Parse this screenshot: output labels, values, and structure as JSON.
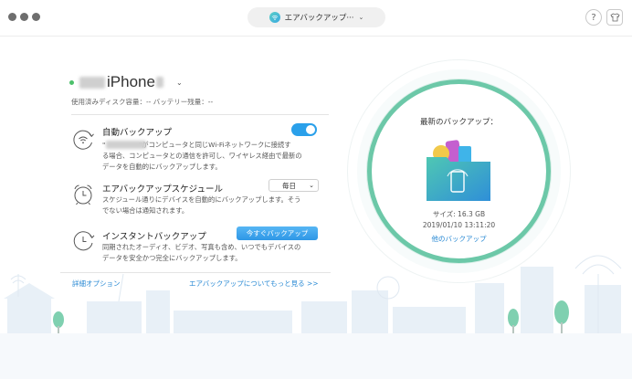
{
  "header": {
    "mode_label": "エアバックアップ···",
    "help_label": "?"
  },
  "device": {
    "name": "iPhone",
    "storage_line": "使用済みディスク容量：-- バッテリー残量：--"
  },
  "options": {
    "auto_backup": {
      "title": "自動バックアップ",
      "desc_line1": "\"　　　　　\"がコンピュータと同じWi-Fiネットワークに接続す",
      "desc_line2": "る場合、コンピュータとの通信を許可し、ワイヤレス経由で最新の",
      "desc_line3": "データを自動的にバックアップします。",
      "enabled": true
    },
    "schedule": {
      "title": "エアバックアップスケジュール",
      "select_value": "毎日",
      "desc_line1": "スケジュール通りにデバイスを自動的にバックアップします。そう",
      "desc_line2": "でない場合は通知されます。"
    },
    "instant": {
      "title": "インスタントバックアップ",
      "button_label": "今すぐバックアップ",
      "desc_line1": "同期されたオーディオ、ビデオ、写真も含め、いつでもデバイスの",
      "desc_line2": "データを安全かつ完全にバックアップします。"
    }
  },
  "links": {
    "details": "詳細オプション",
    "learn_more": "エアバックアップについてもっと見る >>"
  },
  "latest_backup": {
    "title": "最新のバックアップ：",
    "size": "サイズ: 16.3 GB",
    "date": "2019/01/10 13:11:20",
    "other_link": "他のバックアップ"
  },
  "colors": {
    "accent": "#2aa0ea",
    "ring": "#6cc8a8",
    "status": "#4cc06b"
  }
}
